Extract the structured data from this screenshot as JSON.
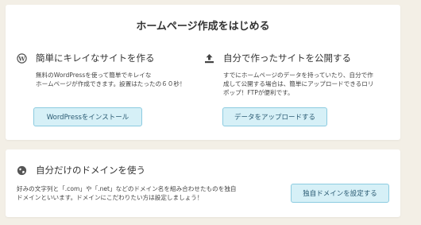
{
  "header": {
    "title": "ホームページ作成をはじめる"
  },
  "wordpress": {
    "icon": "wordpress-icon",
    "heading": "簡単にキレイなサイトを作る",
    "desc_line1": "無料のWordPressを使って簡単でキレイな",
    "desc_line2": "ホームページが作成できます。設置はたったの６０秒！",
    "button": "WordPressをインストール"
  },
  "upload": {
    "icon": "upload-icon",
    "heading": "自分で作ったサイトを公開する",
    "desc_line1": "すでにホームページのデータを持っていたり、自分で作",
    "desc_line2": "成して公開する場合は、簡単にアップロードできるロリ",
    "desc_line3": "ポップ！FTPが便利です。",
    "button": "データをアップロードする"
  },
  "domain": {
    "icon": "globe-icon",
    "heading": "自分だけのドメインを使う",
    "desc_line1": "好みの文字列と「.com」や「.net」などのドメイン名を組み合わせたものを独自",
    "desc_line2": "ドメインといいます。ドメインにこだわりたい方は設定しましょう！",
    "button": "独自ドメインを設定する"
  },
  "colors": {
    "background": "#f3efe6",
    "card": "#ffffff",
    "button_bg": "#d6f0f7",
    "button_border": "#8ccbe0",
    "button_text": "#2a5a72"
  }
}
